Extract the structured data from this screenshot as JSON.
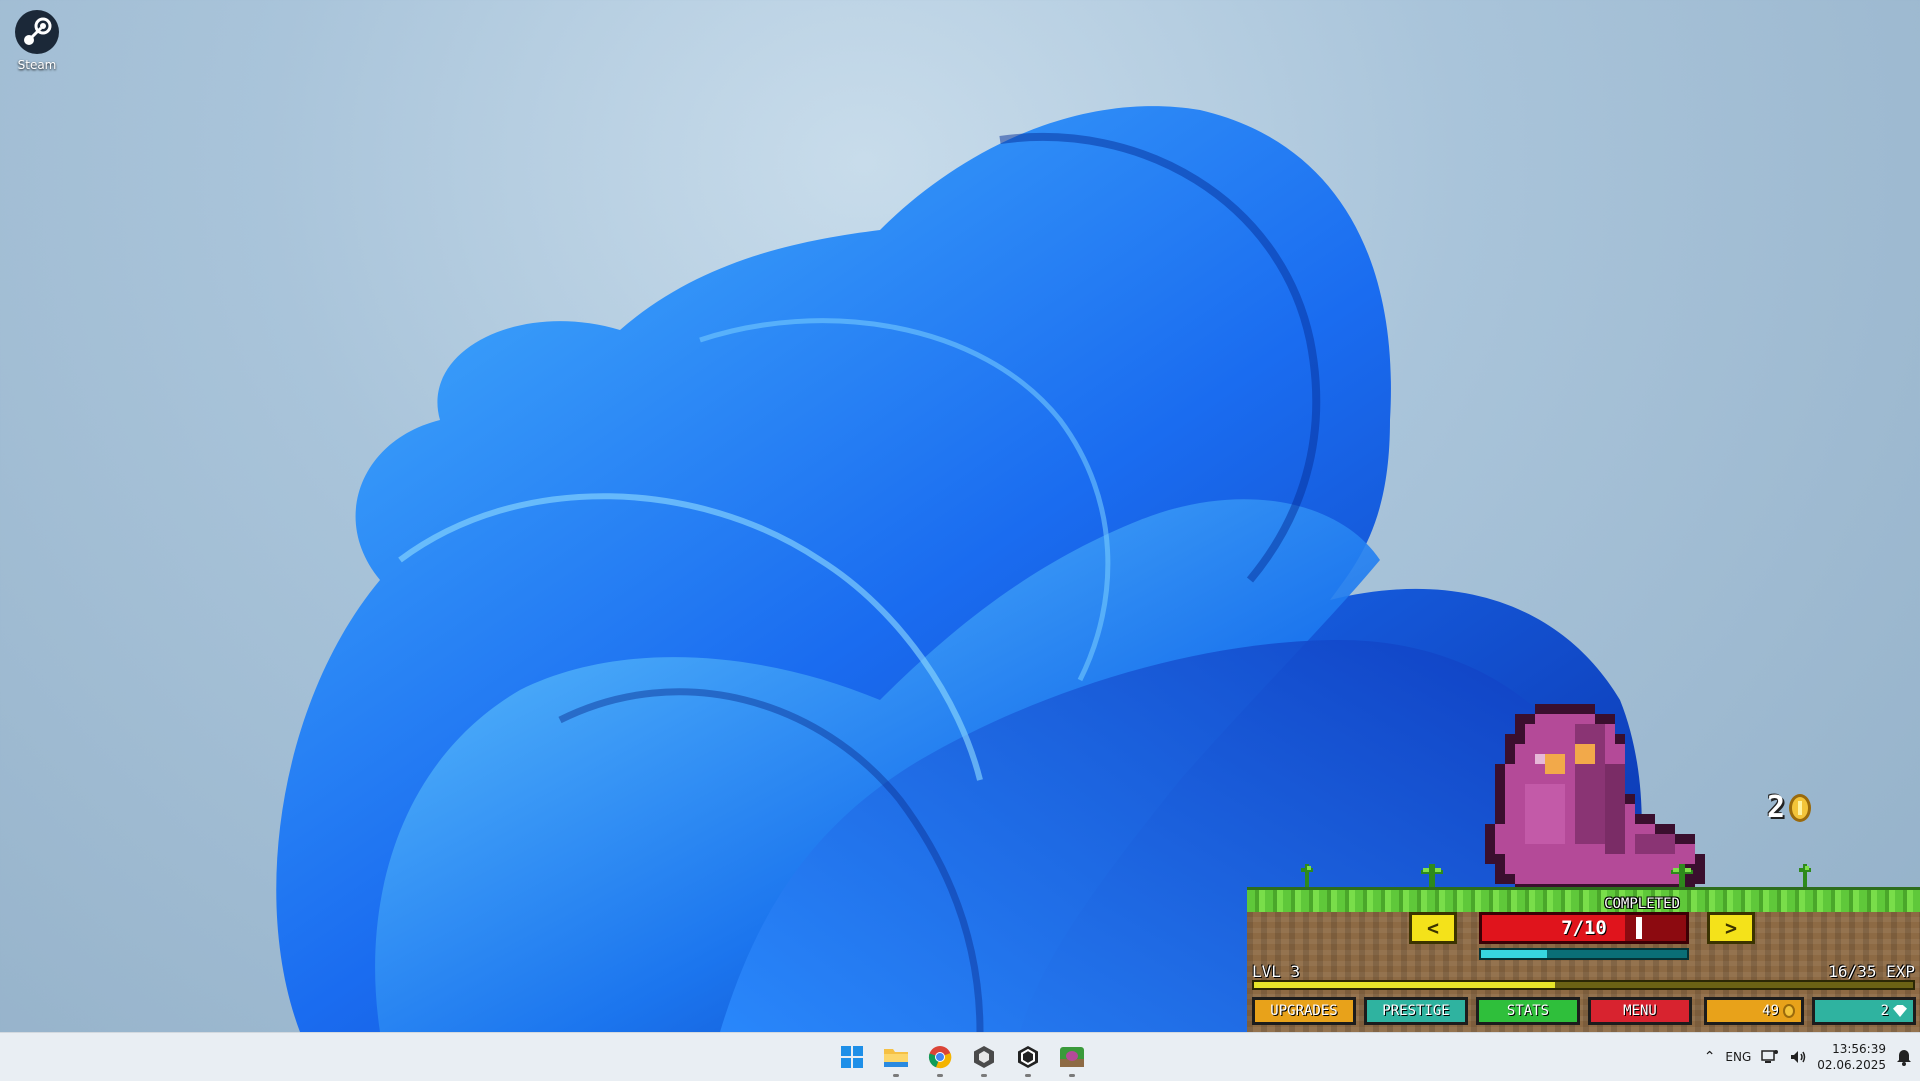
{
  "desktop": {
    "icons": [
      {
        "label": "Steam",
        "icon": "steam-icon"
      }
    ]
  },
  "game": {
    "reward": {
      "amount": "2",
      "icon": "coin-icon"
    },
    "status": "COMPLETED",
    "enemy": {
      "health_text": "7/10",
      "health_fraction": 0.7,
      "icon": "slime-enemy"
    },
    "timer_fraction": 0.32,
    "level": {
      "label": "LVL 3",
      "exp_text": "16/35 EXP",
      "exp_fraction": 0.457
    },
    "buttons": {
      "prev": "<",
      "next": ">",
      "upgrades": "UPGRADES",
      "prestige": "PRESTIGE",
      "stats": "STATS",
      "menu": "MENU"
    },
    "currency": {
      "coins": "49",
      "gems": "2"
    },
    "colors": {
      "upgrades": "#e8a21a",
      "prestige": "#2fb3a0",
      "stats": "#2fbf3b",
      "menu": "#d8232f",
      "coins": "#e8a21a",
      "gems": "#2fb3a0"
    }
  },
  "taskbar": {
    "apps": [
      {
        "name": "start-icon"
      },
      {
        "name": "file-explorer-icon"
      },
      {
        "name": "chrome-icon"
      },
      {
        "name": "unity-hub-icon"
      },
      {
        "name": "unity-icon"
      },
      {
        "name": "game-icon"
      }
    ],
    "tray": {
      "language": "ENG",
      "time": "13:56:39",
      "date": "02.06.2025"
    }
  }
}
